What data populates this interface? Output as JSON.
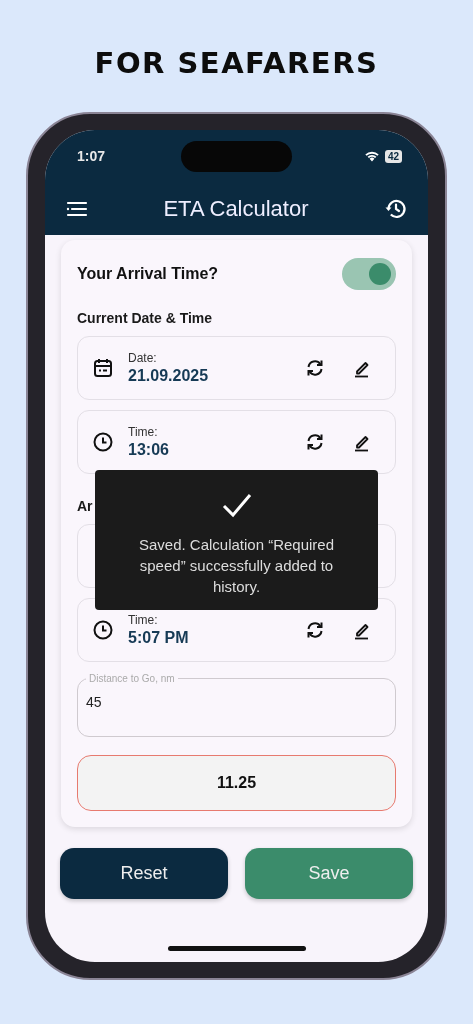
{
  "headline": "FOR SEAFARERS",
  "status_bar": {
    "time": "1:07",
    "battery": "42"
  },
  "app_bar": {
    "title": "ETA Calculator"
  },
  "toggle": {
    "label": "Your Arrival Time?",
    "on": true
  },
  "sections": [
    {
      "title": "Current Date & Time",
      "rows": [
        {
          "kind": "date",
          "label": "Date:",
          "value": "21.09.2025"
        },
        {
          "kind": "time",
          "label": "Time:",
          "value": "13:06"
        }
      ]
    },
    {
      "title": "Ar",
      "rows": [
        {
          "kind": "covered"
        },
        {
          "kind": "time",
          "label": "Time:",
          "value": "5:07 PM"
        }
      ]
    }
  ],
  "distance_field": {
    "label": "Distance to Go, nm",
    "value": "45"
  },
  "result": {
    "value": "11.25"
  },
  "buttons": [
    {
      "kind": "reset",
      "label": "Reset"
    },
    {
      "kind": "save",
      "label": "Save"
    }
  ],
  "toast": {
    "message": "Saved. Calculation “Required speed” successfully added to history."
  }
}
